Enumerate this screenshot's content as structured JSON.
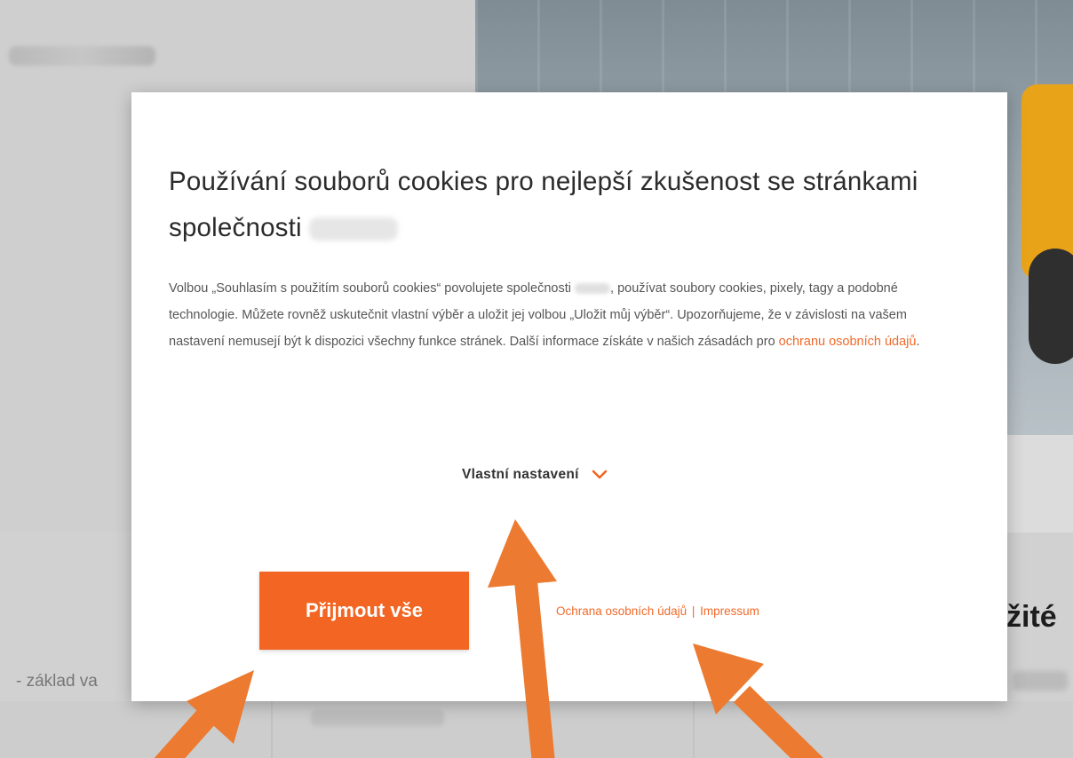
{
  "background": {
    "side_text": "- základ va",
    "right_heading": "žité"
  },
  "modal": {
    "title": "Používání souborů cookies pro nejlepší zkušenost se stránkami společnosti",
    "description_part1": "Volbou „Souhlasím s použitím souborů cookies“ povolujete společnosti",
    "description_part2": ", používat soubory cookies, pixely, tagy a podobné technologie. Můžete rovněž uskutečnit vlastní výběr a uložit jej volbou „Uložit můj výběr“. Upozorňujeme, že v závislosti na vašem nastavení nemusejí být k dispozici všechny funkce stránek. Další informace získáte v našich zásadách pro",
    "privacy_link": "ochranu osobních údajů",
    "description_end": ".",
    "custom_settings_label": "Vlastní nastavení",
    "accept_all_label": "Přijmout vše",
    "footer_privacy_link": "Ochrana osobních údajů",
    "footer_separator": "|",
    "footer_impressum_link": "Impressum"
  },
  "colors": {
    "accent": "#f26522",
    "link": "#f06a2a",
    "arrow": "#ec7a30"
  },
  "icons": {
    "custom_settings_chevron": "chevron-down-icon"
  }
}
